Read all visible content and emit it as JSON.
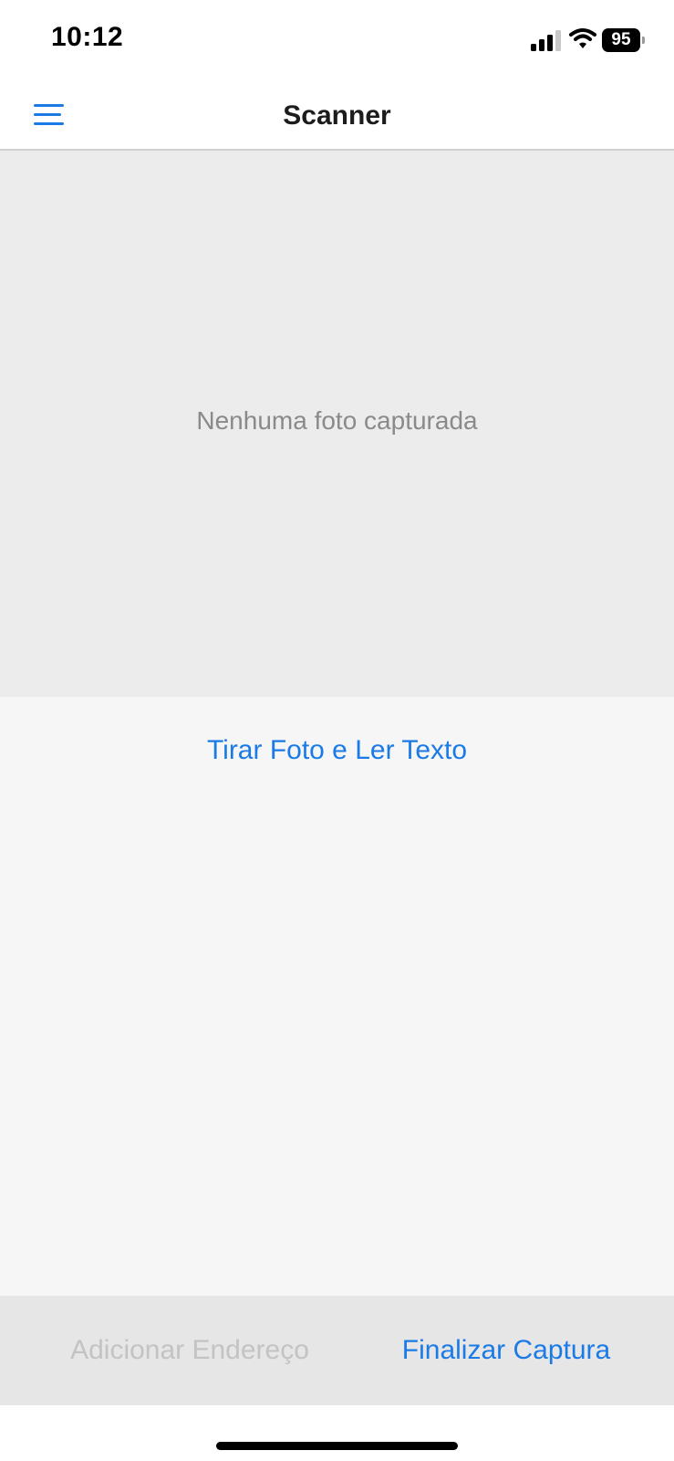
{
  "status_bar": {
    "time": "10:12",
    "battery_level": "95",
    "icons": [
      "signal-icon",
      "wifi-icon",
      "battery-icon"
    ]
  },
  "nav": {
    "title": "Scanner",
    "menu_icon": "hamburger-menu-icon"
  },
  "preview": {
    "empty_text": "Nenhuma foto capturada"
  },
  "actions": {
    "capture_label": "Tirar Foto e Ler Texto"
  },
  "bottom_bar": {
    "add_address_label": "Adicionar Endereço",
    "add_address_enabled": false,
    "finish_label": "Finalizar Captura"
  },
  "colors": {
    "accent": "#1a7ae6",
    "disabled": "#c3c3c3",
    "preview_bg": "#ececec",
    "content_bg": "#f6f6f6",
    "bottom_bar_bg": "#e6e6e6"
  }
}
